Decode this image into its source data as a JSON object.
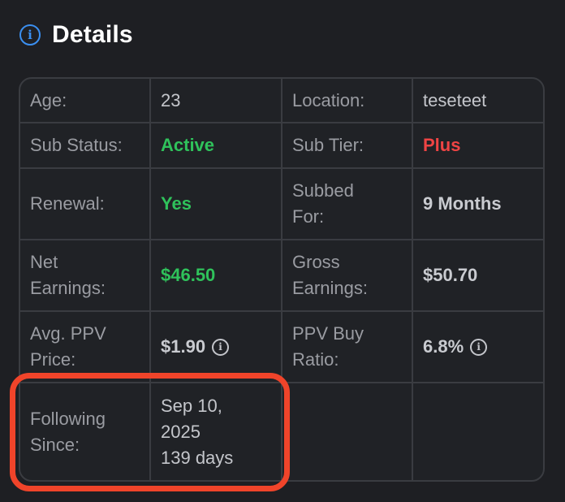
{
  "header": {
    "title": "Details",
    "icon": "info-circle-icon"
  },
  "details": {
    "age_label": "Age:",
    "age_value": "23",
    "location_label": "Location:",
    "location_value": "teseteet",
    "sub_status_label": "Sub Status:",
    "sub_status_value": "Active",
    "sub_tier_label": "Sub Tier:",
    "sub_tier_value": "Plus",
    "renewal_label": "Renewal:",
    "renewal_value": "Yes",
    "subbed_for_label_1": "Subbed",
    "subbed_for_label_2": "For:",
    "subbed_for_value": "9 Months",
    "net_earnings_label_1": "Net",
    "net_earnings_label_2": "Earnings:",
    "net_earnings_value": "$46.50",
    "gross_earnings_label_1": "Gross",
    "gross_earnings_label_2": "Earnings:",
    "gross_earnings_value": "$50.70",
    "avg_ppv_label_1": "Avg. PPV",
    "avg_ppv_label_2": "Price:",
    "avg_ppv_value": "$1.90",
    "ppv_buy_label_1": "PPV Buy",
    "ppv_buy_label_2": "Ratio:",
    "ppv_buy_value": "6.8%",
    "following_label_1": "Following",
    "following_label_2": "Since:",
    "following_date_1": "Sep 10,",
    "following_date_2": "2025",
    "following_days": "139 days"
  },
  "colors": {
    "accent": "#3b8ff0",
    "positive": "#2fc25b",
    "negative": "#ef4444",
    "highlight": "#f0442a"
  }
}
